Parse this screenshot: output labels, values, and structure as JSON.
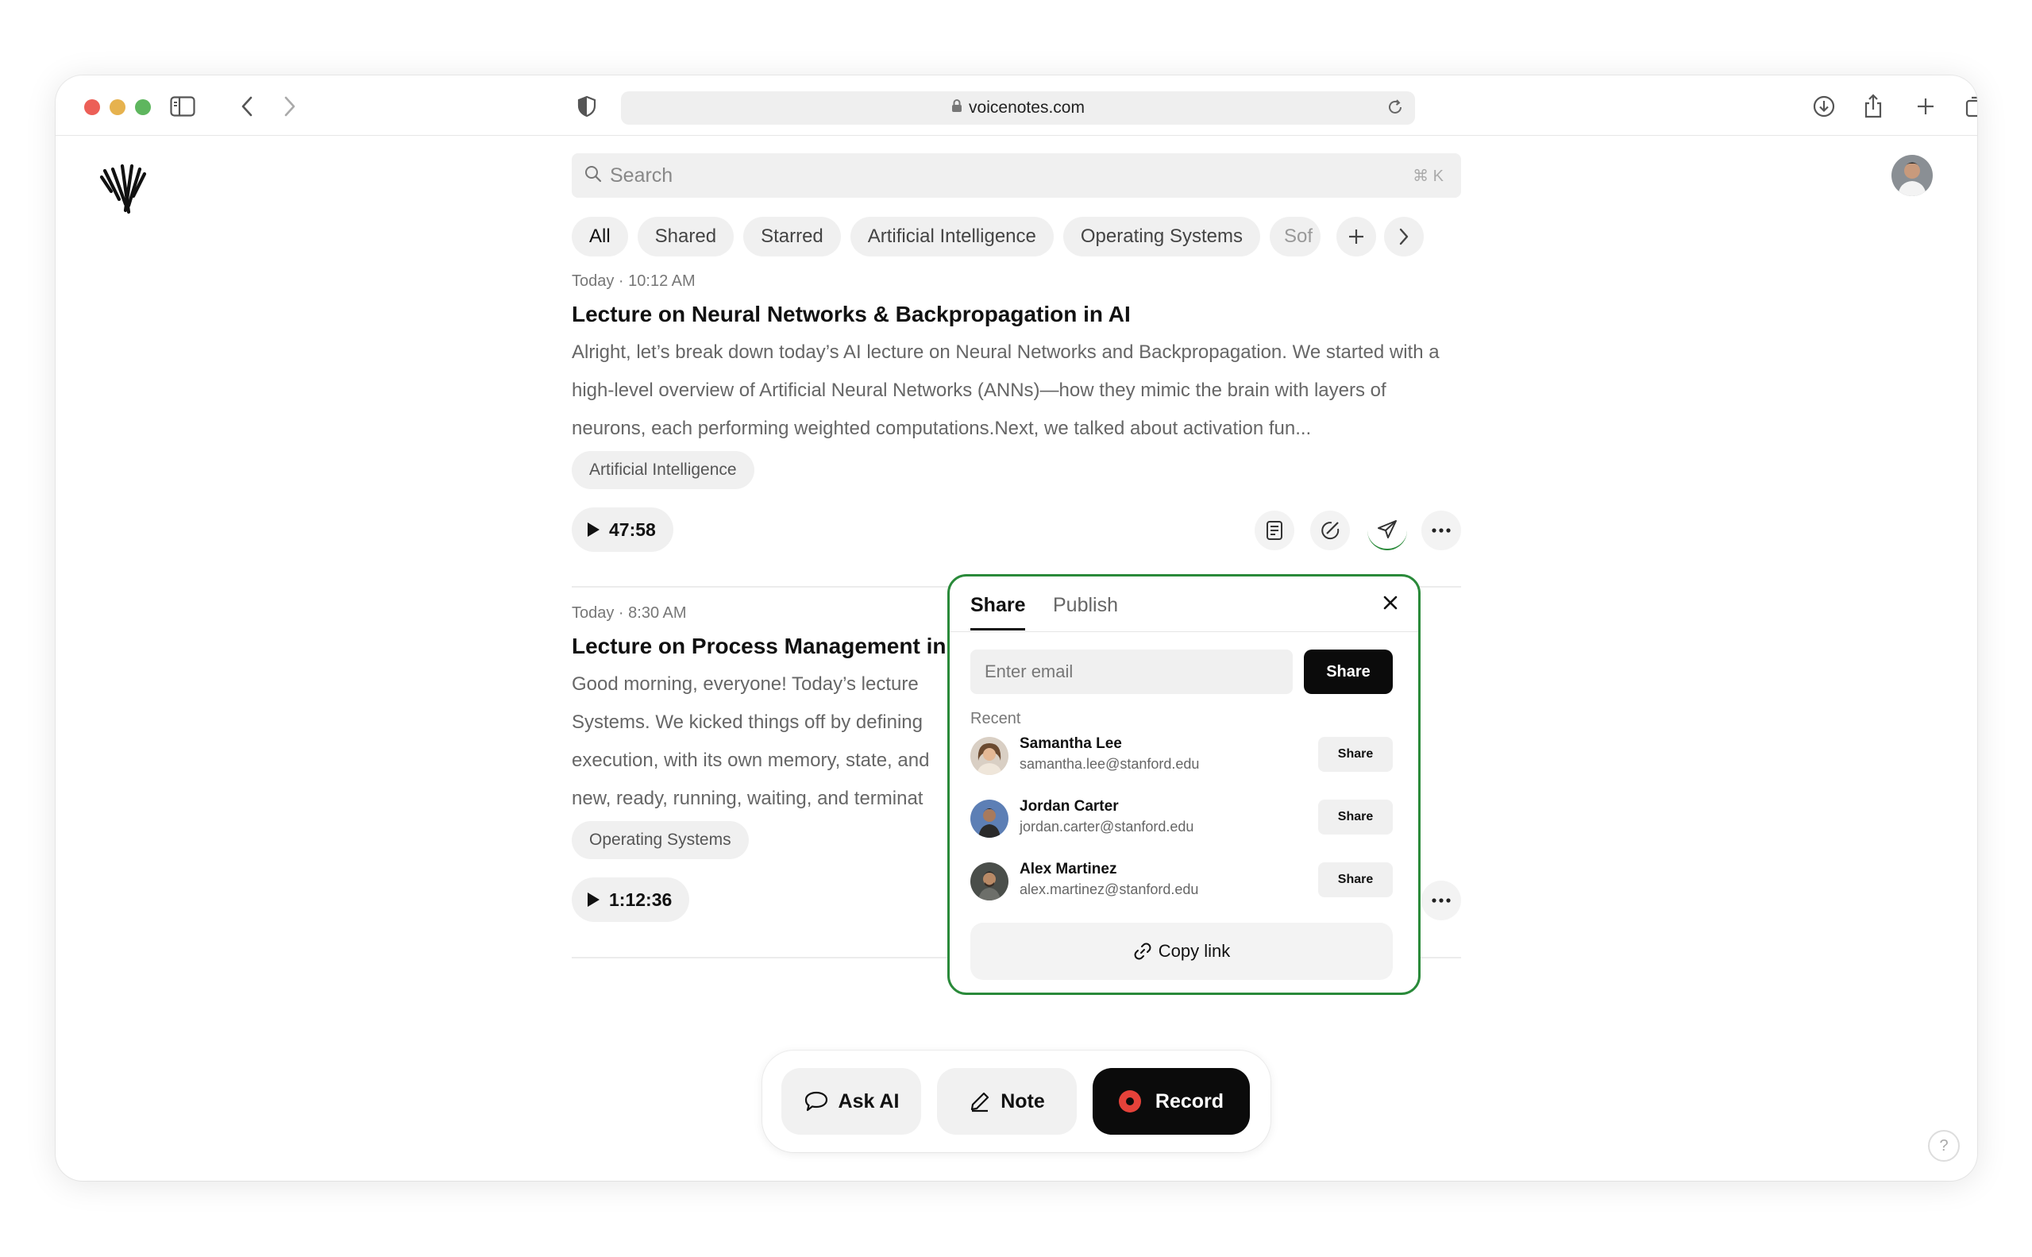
{
  "browser": {
    "url": "voicenotes.com"
  },
  "search": {
    "placeholder": "Search",
    "shortcut": "⌘ K"
  },
  "filters": [
    "All",
    "Shared",
    "Starred",
    "Artificial Intelligence",
    "Operating Systems",
    "Sof"
  ],
  "notes": [
    {
      "meta": "Today · 10:12 AM",
      "title": "Lecture on Neural Networks & Backpropagation in AI",
      "excerpt": "Alright, let’s break down today’s AI lecture on Neural Networks and Backpropagation. We started with a high-level overview of Artificial Neural Networks (ANNs)—how they mimic the brain with layers of neurons, each performing weighted computations.Next, we talked about activation fun...",
      "tag": "Artificial Intelligence",
      "duration": "47:58"
    },
    {
      "meta": "Today · 8:30 AM",
      "title": "Lecture on Process Management in",
      "excerpt_lines": [
        "Good morning, everyone! Today’s lecture",
        "Systems. We kicked things off by defining",
        "execution, with its own memory, state, and",
        "new, ready, running, waiting, and terminat"
      ],
      "tag": "Operating Systems",
      "duration": "1:12:36"
    }
  ],
  "share_popup": {
    "tab_share": "Share",
    "tab_publish": "Publish",
    "email_placeholder": "Enter email",
    "share_button": "Share",
    "recent_label": "Recent",
    "contacts": [
      {
        "name": "Samantha Lee",
        "email": "samantha.lee@stanford.edu",
        "button": "Share"
      },
      {
        "name": "Jordan Carter",
        "email": "jordan.carter@stanford.edu",
        "button": "Share"
      },
      {
        "name": "Alex Martinez",
        "email": "alex.martinez@stanford.edu",
        "button": "Share"
      }
    ],
    "copy_link": "Copy link"
  },
  "toolbar": {
    "ask_ai": "Ask AI",
    "note": "Note",
    "record": "Record"
  },
  "help": "?",
  "colors": {
    "accent_green": "#2a8a3a",
    "record_red": "#e5423a",
    "primary_black": "#0b0b0b"
  }
}
